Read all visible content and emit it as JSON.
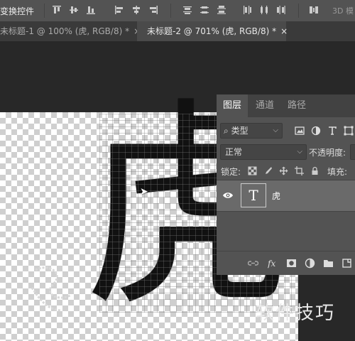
{
  "options_bar": {
    "label": "变换控件",
    "mode_3d": "3D 模"
  },
  "tabs": [
    {
      "label": "未标题-1 @ 100% (虎, RGB/8) *",
      "close": "×",
      "active": false
    },
    {
      "label": "未标题-2 @ 701% (虎, RGB/8) *",
      "close": "×",
      "active": true
    }
  ],
  "canvas": {
    "glyph": "虎",
    "watermark": "软件技巧"
  },
  "layers_panel": {
    "tabs": [
      "图层",
      "通道",
      "路径"
    ],
    "filter": {
      "value": "类型",
      "icon": "search-icon"
    },
    "blend_mode": "正常",
    "opacity_label": "不透明度:",
    "lock_label": "锁定:",
    "fill_label": "填充:",
    "layer": {
      "name": "虎",
      "thumbnail": "T",
      "type": "text-layer"
    }
  },
  "colors": {
    "panel_bg": "#535353",
    "selected_row": "#6a6a6a",
    "tab_bar": "#3a3a3a"
  }
}
